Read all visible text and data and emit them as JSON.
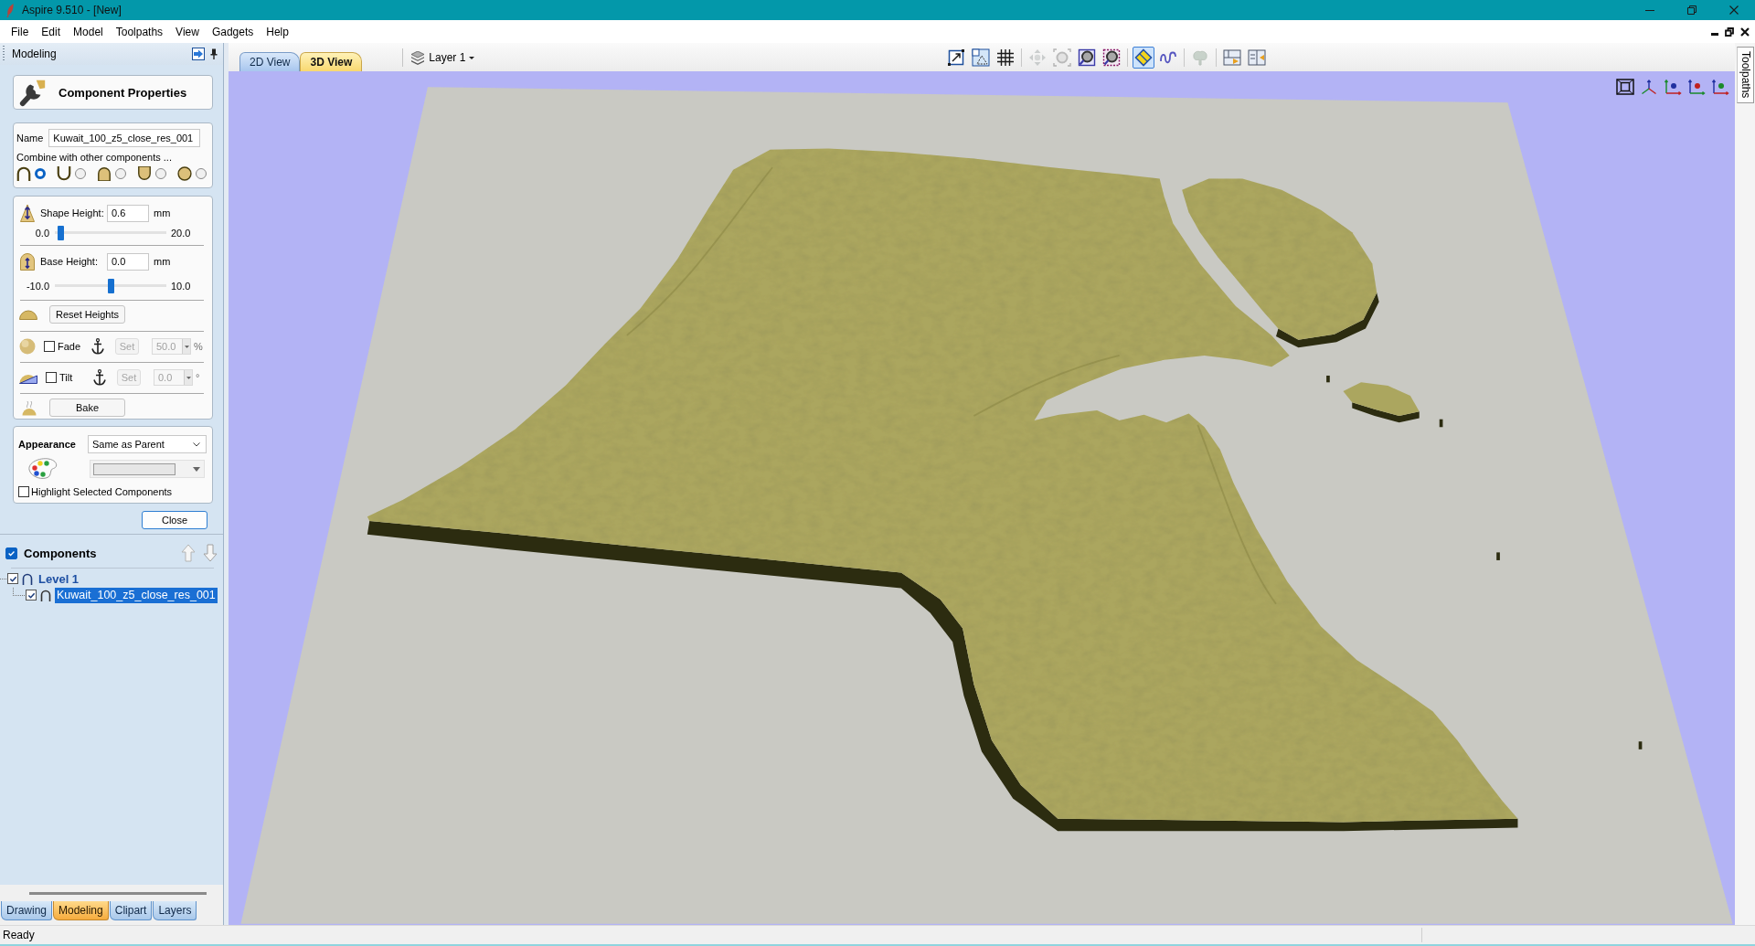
{
  "window": {
    "title": "Aspire 9.510 - [New]"
  },
  "menu": [
    "File",
    "Edit",
    "Model",
    "Toolpaths",
    "View",
    "Gadgets",
    "Help"
  ],
  "panel": {
    "title": "Modeling",
    "header": "Component Properties",
    "name": {
      "label": "Name",
      "value": "Kuwait_100_z5_close_res_001"
    },
    "combine": {
      "label": "Combine with other components ...",
      "options": [
        {
          "selected": true
        },
        {
          "selected": false
        },
        {
          "selected": false
        },
        {
          "selected": false
        },
        {
          "selected": false
        }
      ]
    },
    "heights": [
      {
        "label": "Shape Height:",
        "value": "0.6",
        "unit": "mm",
        "min": "0.0",
        "max": "20.0",
        "level": 0.03
      },
      {
        "label": "Base Height:",
        "value": "0.0",
        "unit": "mm",
        "min": "-10.0",
        "max": "10.0",
        "level": 0.5
      }
    ],
    "reset_button": "Reset Heights",
    "adjust_rows": [
      {
        "label": "Fade",
        "checked": false,
        "button": "Set",
        "value": "50.0",
        "unit": "%",
        "disabled": true
      },
      {
        "label": "Tilt",
        "checked": false,
        "button": "Set",
        "value": "0.0",
        "unit": "°",
        "disabled": true
      }
    ],
    "bake_button": "Bake",
    "appearance": {
      "label": "Appearance",
      "value": "Same as Parent",
      "color_picker": {
        "disabled": true
      },
      "highlight": {
        "label": "Highlight Selected Components",
        "checked": false
      }
    },
    "close_button": "Close"
  },
  "components": {
    "title": "Components",
    "checked": true,
    "tree": [
      {
        "label": "Level 1",
        "checked": true,
        "selected": false,
        "children": [
          {
            "label": "Kuwait_100_z5_close_res_001",
            "checked": true,
            "selected": true
          }
        ]
      }
    ]
  },
  "panel_tabs": [
    {
      "label": "Drawing",
      "selected": false
    },
    {
      "label": "Modeling",
      "selected": true
    },
    {
      "label": "Clipart",
      "selected": false
    },
    {
      "label": "Layers",
      "selected": false
    }
  ],
  "view_tabs": [
    {
      "label": "2D View",
      "selected": false
    },
    {
      "label": "3D View",
      "selected": true
    }
  ],
  "layer": {
    "label": "Layer 1"
  },
  "toolbar": {
    "groups": [
      [
        {
          "on": false,
          "disabled": false
        },
        {
          "on": false,
          "disabled": false
        },
        {
          "on": false,
          "disabled": false
        }
      ],
      [
        {
          "on": false,
          "disabled": true
        },
        {
          "on": false,
          "disabled": true
        },
        {
          "on": false,
          "disabled": false
        },
        {
          "on": false,
          "disabled": false
        }
      ],
      [
        {
          "on": true,
          "disabled": false
        },
        {
          "on": false,
          "disabled": false
        }
      ],
      [
        {
          "on": false,
          "disabled": true
        }
      ],
      [
        {
          "on": false,
          "disabled": false
        },
        {
          "on": false,
          "disabled": false
        }
      ]
    ]
  },
  "side_tabs": [
    {
      "label": "Toolpaths"
    }
  ],
  "status_bar": {
    "text": "Ready"
  }
}
